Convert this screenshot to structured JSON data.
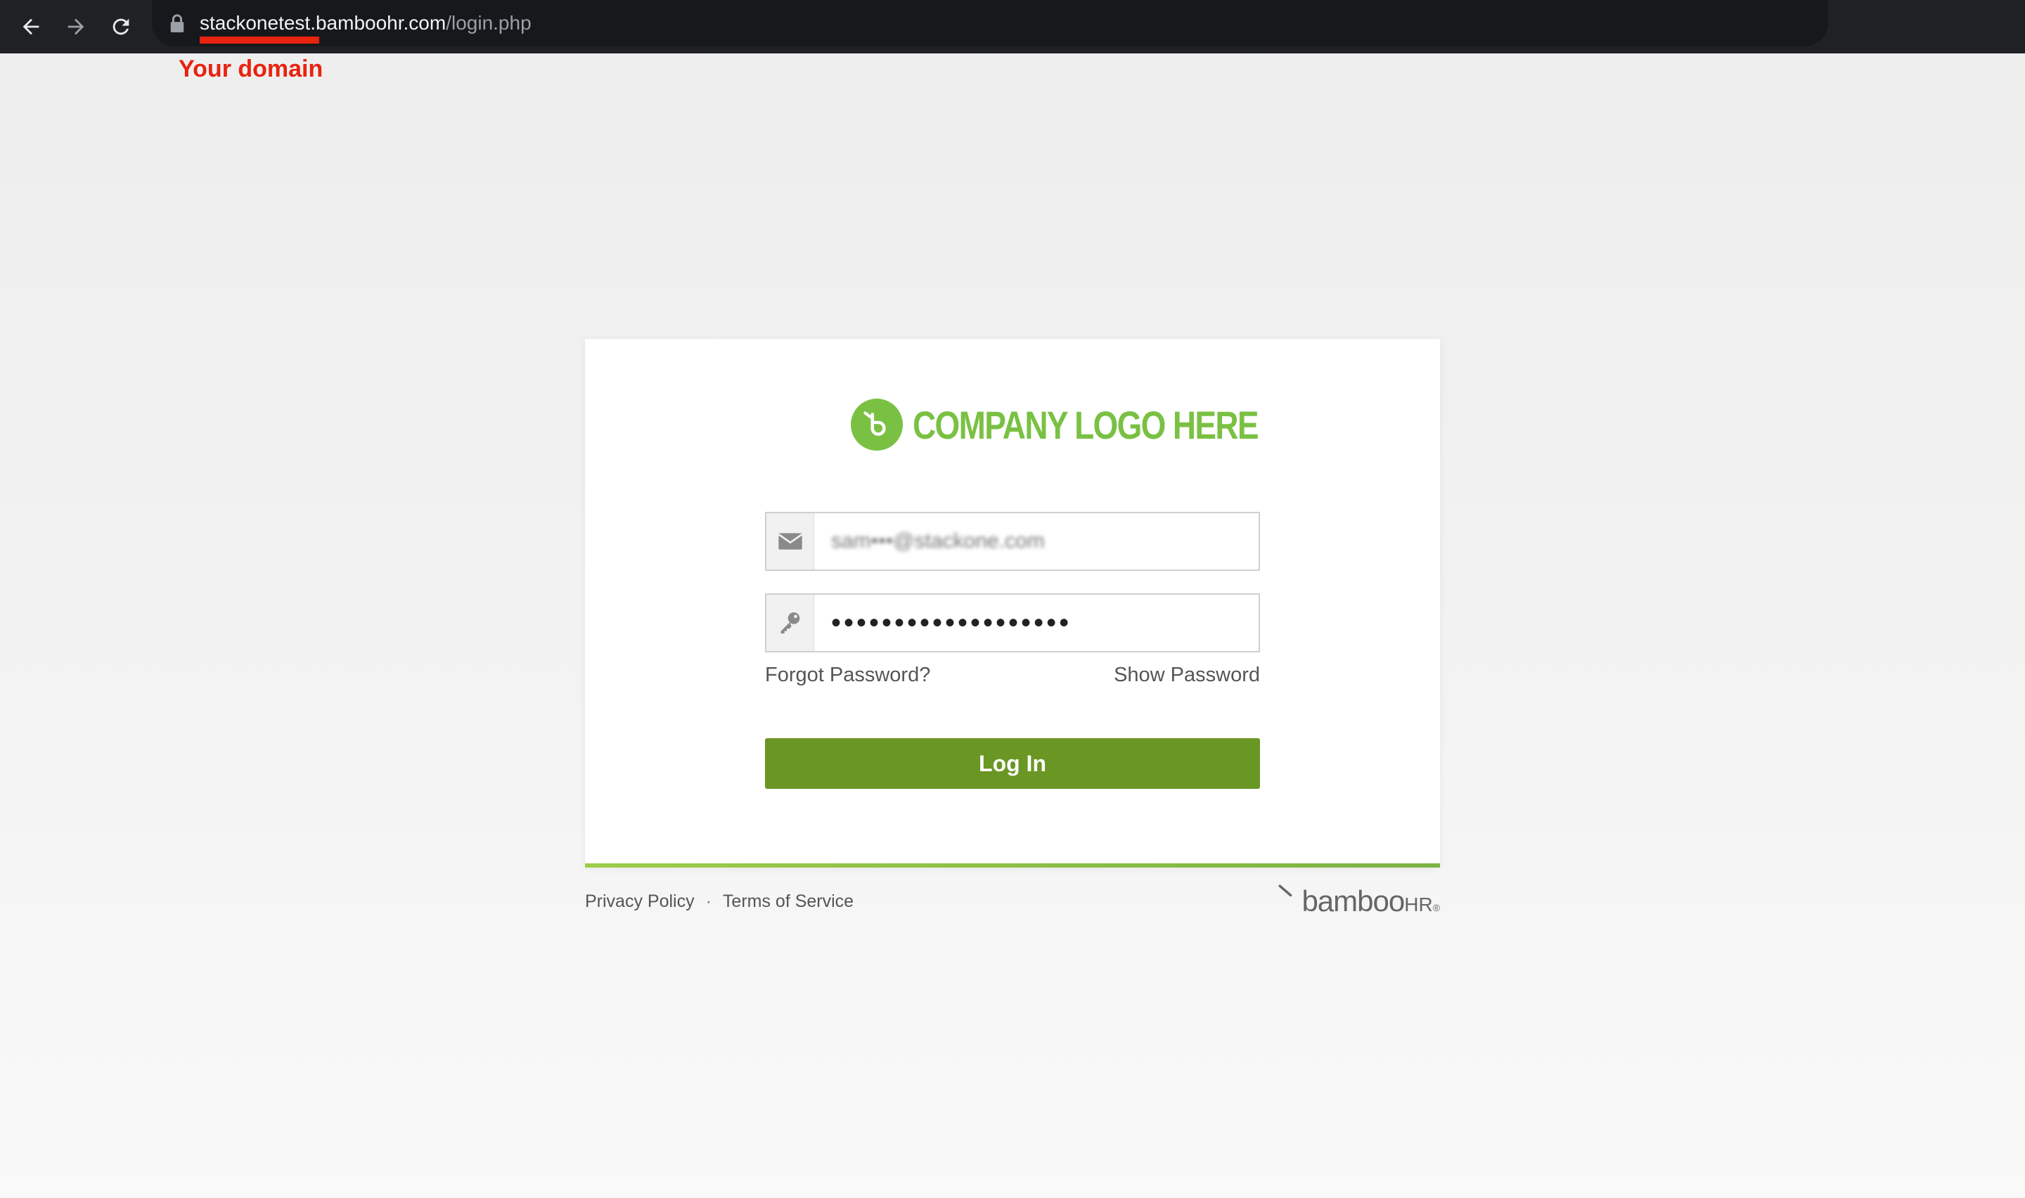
{
  "browser": {
    "url_host": "stackonetest.bamboohr.com",
    "url_path": "/login.php",
    "annotation_label": "Your domain",
    "annotation_color": "#e8230f"
  },
  "login": {
    "logo_text": "COMPANY LOGO HERE",
    "email_value": "sam•••@stackone.com",
    "password_value": "•••••••••••••••••••",
    "forgot_password": "Forgot Password?",
    "show_password": "Show Password",
    "login_button": "Log In"
  },
  "footer": {
    "privacy": "Privacy Policy",
    "separator": "·",
    "terms": "Terms of Service",
    "brand_main": "bamboo",
    "brand_hr": "HR",
    "brand_reg": "®"
  },
  "colors": {
    "brand_green": "#7ac143",
    "button_green": "#6a9623",
    "toolbar": "#202124"
  },
  "icons": [
    "back-icon",
    "forward-icon",
    "reload-icon",
    "lock-icon",
    "mail-icon",
    "key-icon",
    "bamboo-logo-icon"
  ]
}
